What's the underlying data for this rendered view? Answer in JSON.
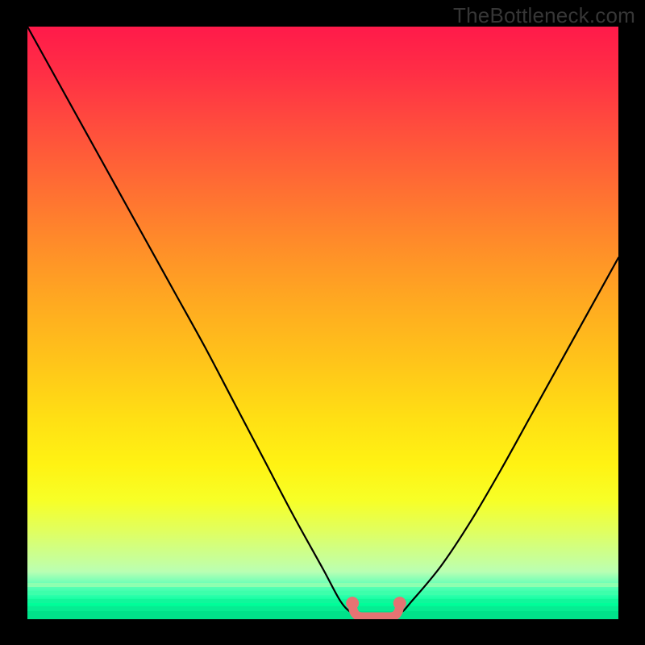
{
  "watermark": "TheBottleneck.com",
  "colors": {
    "frame": "#000000",
    "curve": "#000000",
    "marker": "#e57373",
    "watermark_text": "#363636"
  },
  "chart_data": {
    "type": "line",
    "title": "",
    "xlabel": "",
    "ylabel": "",
    "xlim": [
      0,
      100
    ],
    "ylim": [
      0,
      100
    ],
    "series": [
      {
        "name": "bottleneck-curve",
        "x": [
          0,
          5,
          10,
          15,
          20,
          25,
          30,
          35,
          40,
          45,
          50,
          53,
          55,
          57,
          60,
          63,
          65,
          70,
          75,
          80,
          85,
          90,
          95,
          100
        ],
        "values": [
          100,
          91,
          82,
          73,
          64,
          55,
          46,
          36.5,
          27,
          17.5,
          8.5,
          3,
          1,
          0.4,
          0.4,
          1,
          3,
          9,
          16.5,
          25,
          34,
          43,
          52,
          61
        ]
      }
    ],
    "flat_region": {
      "x_start": 55,
      "x_end": 63,
      "value": 0.4
    },
    "annotations": [
      {
        "text": "TheBottleneck.com",
        "role": "watermark",
        "pos": "top-right"
      }
    ]
  }
}
